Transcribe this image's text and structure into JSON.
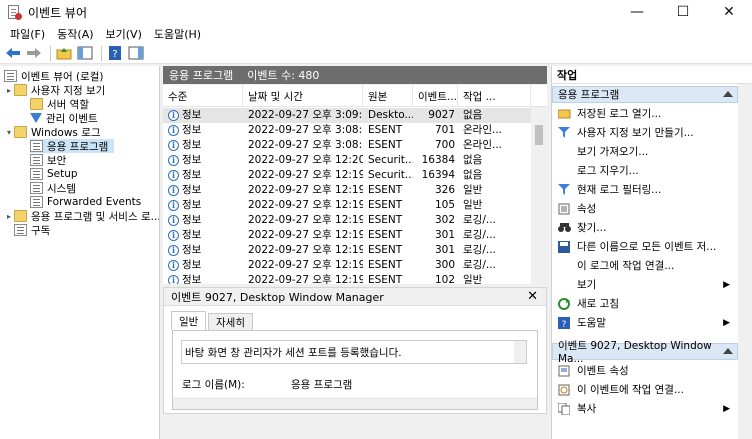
{
  "window": {
    "title": "이벤트 뷰어",
    "minimize": "—",
    "maximize": "☐",
    "close": "✕"
  },
  "menu": [
    "파일(F)",
    "동작(A)",
    "보기(V)",
    "도움말(H)"
  ],
  "tree": [
    {
      "label": "이벤트 뷰어 (로컬)",
      "icon": "event-viewer-icon"
    },
    {
      "label": "사용자 지정 보기",
      "icon": "folder-icon",
      "arrow": "▸"
    },
    {
      "label": "서버 역할",
      "icon": "folder-icon"
    },
    {
      "label": "관리 이벤트",
      "icon": "filter-icon"
    },
    {
      "label": "Windows 로그",
      "icon": "folder-icon",
      "arrow": "▾"
    },
    {
      "label": "응용 프로그램",
      "icon": "log-icon"
    },
    {
      "label": "보안",
      "icon": "log-icon"
    },
    {
      "label": "Setup",
      "icon": "log-icon"
    },
    {
      "label": "시스템",
      "icon": "log-icon"
    },
    {
      "label": "Forwarded Events",
      "icon": "log-icon"
    },
    {
      "label": "응용 프로그램 및 서비스 로...",
      "icon": "folder-icon",
      "arrow": "▸"
    },
    {
      "label": "구독",
      "icon": "subscription-icon"
    }
  ],
  "center": {
    "log_name": "응용 프로그램",
    "event_count": "이벤트 수: 480",
    "columns": [
      "수준",
      "날짜 및 시간",
      "원본",
      "이벤트...",
      "작업 ..."
    ],
    "rows": [
      [
        "정보",
        "2022-09-27 오후 3:09:...",
        "Deskto...",
        "9027",
        "없음"
      ],
      [
        "정보",
        "2022-09-27 오후 3:08:...",
        "ESENT",
        "701",
        "온라인..."
      ],
      [
        "정보",
        "2022-09-27 오후 3:08:...",
        "ESENT",
        "700",
        "온라인..."
      ],
      [
        "정보",
        "2022-09-27 오후 12:20...",
        "Securit...",
        "16384",
        "없음"
      ],
      [
        "정보",
        "2022-09-27 오후 12:19...",
        "Securit...",
        "16394",
        "없음"
      ],
      [
        "정보",
        "2022-09-27 오후 12:19...",
        "ESENT",
        "326",
        "일반"
      ],
      [
        "정보",
        "2022-09-27 오후 12:19...",
        "ESENT",
        "105",
        "일반"
      ],
      [
        "정보",
        "2022-09-27 오후 12:19...",
        "ESENT",
        "302",
        "로깅/..."
      ],
      [
        "정보",
        "2022-09-27 오후 12:19...",
        "ESENT",
        "301",
        "로깅/..."
      ],
      [
        "정보",
        "2022-09-27 오후 12:19...",
        "ESENT",
        "301",
        "로깅/..."
      ],
      [
        "정보",
        "2022-09-27 오후 12:19...",
        "ESENT",
        "300",
        "로깅/..."
      ],
      [
        "정보",
        "2022-09-27 오후 12:19...",
        "ESENT",
        "102",
        "일반"
      ]
    ]
  },
  "detail": {
    "title": "이벤트 9027, Desktop Window Manager",
    "close": "✕",
    "tabs": [
      "일반",
      "자세히"
    ],
    "message": "바탕 화면 창 관리자가 세션 포트를 등록했습니다.",
    "log_name_label": "로그 이름(M):",
    "log_name_value": "응용 프로그램"
  },
  "actions": {
    "title": "작업",
    "section1": "응용 프로그램",
    "items1": [
      {
        "label": "저장된 로그 열기...",
        "icon": "folder-open-icon"
      },
      {
        "label": "사용자 지정 보기 만들기...",
        "icon": "filter-icon"
      },
      {
        "label": "보기 가져오기...",
        "icon": ""
      },
      {
        "label": "로그 지우기...",
        "icon": ""
      },
      {
        "label": "현재 로그 필터링...",
        "icon": "filter-icon"
      },
      {
        "label": "속성",
        "icon": "properties-icon"
      },
      {
        "label": "찾기...",
        "icon": "binoculars-icon"
      },
      {
        "label": "다른 이름으로 모든 이벤트 저...",
        "icon": "save-icon"
      },
      {
        "label": "이 로그에 작업 연결...",
        "icon": ""
      },
      {
        "label": "보기",
        "icon": "",
        "submenu": "▶"
      },
      {
        "label": "새로 고침",
        "icon": "refresh-icon"
      },
      {
        "label": "도움말",
        "icon": "help-icon",
        "submenu": "▶"
      }
    ],
    "section2": "이벤트 9027, Desktop Window Ma...",
    "items2": [
      {
        "label": "이벤트 속성",
        "icon": "event-properties-icon"
      },
      {
        "label": "이 이벤트에 작업 연결...",
        "icon": "task-icon"
      },
      {
        "label": "복사",
        "icon": "copy-icon",
        "submenu": "▶"
      }
    ]
  }
}
